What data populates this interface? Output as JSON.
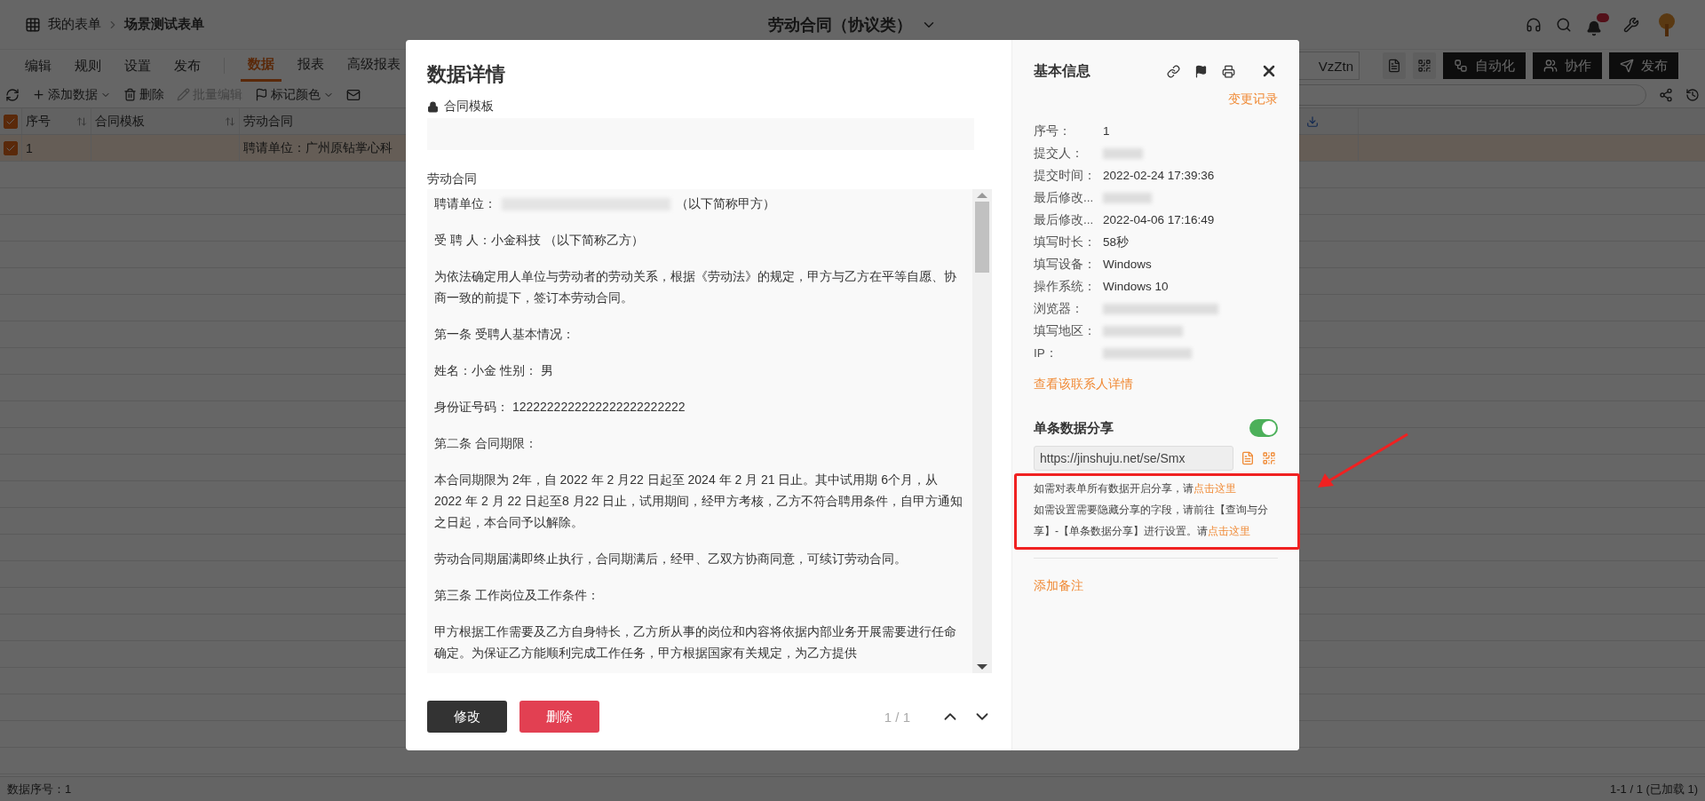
{
  "topbar": {
    "breadcrumb": [
      "我的表单",
      "场景测试表单"
    ],
    "title": "劳动合同（协议类）"
  },
  "menu": [
    "编辑",
    "规则",
    "设置",
    "发布"
  ],
  "tabs": [
    {
      "label": "数据",
      "selected": true
    },
    {
      "label": "报表",
      "selected": false
    },
    {
      "label": "高级报表",
      "selected": false
    }
  ],
  "form_link": {
    "value": "VzZtn"
  },
  "header_buttons": [
    "自动化",
    "协作",
    "发布"
  ],
  "toolbar": [
    {
      "label": "添加数据",
      "disabled": false,
      "dropdown": true
    },
    {
      "label": "删除",
      "disabled": false,
      "dropdown": false
    },
    {
      "label": "批量编辑",
      "disabled": true,
      "dropdown": false
    },
    {
      "label": "标记颜色",
      "disabled": false,
      "dropdown": true
    }
  ],
  "table": {
    "all_checked": true,
    "columns": [
      {
        "label": "序号",
        "sortable": true
      },
      {
        "label": "合同模板",
        "sortable": true
      },
      {
        "label": "劳动合同",
        "sortable": false
      }
    ],
    "rows": [
      {
        "checked": true,
        "selected": true,
        "number": "1",
        "contract": "聘请单位：广州原钻掌心科"
      }
    ]
  },
  "status_bar": {
    "left": "数据序号：1",
    "right": "1-1 / 1 (已加载 1)"
  },
  "modal": {
    "title": "数据详情",
    "template_field": {
      "label": "合同模板",
      "locked": true
    },
    "contract_label": "劳动合同",
    "paragraphs": [
      [
        {
          "text": "聘请单位："
        },
        {
          "redacted": true
        },
        {
          "text": "（以下简称甲方）"
        }
      ],
      [
        {
          "text": "受 聘 人：小金科技 （以下简称乙方）"
        }
      ],
      [
        {
          "text": "为依法确定用人单位与劳动者的劳动关系，根据《劳动法》的规定，甲方与乙方在平等自愿、协商一致的前提下，签订本劳动合同。"
        }
      ],
      [
        {
          "text": "第一条 受聘人基本情况："
        }
      ],
      [
        {
          "text": "姓名：小金 性别： 男"
        }
      ],
      [
        {
          "text": "身份证号码： 1222222222222222222222222"
        }
      ],
      [
        {
          "text": "第二条 合同期限："
        }
      ],
      [
        {
          "text": "本合同期限为 2年，自 2022 年 2 月22 日起至 2024 年 2 月 21 日止。其中试用期 6个月，从 2022 年 2 月 22 日起至8 月22 日止，试用期间，经甲方考核，乙方不符合聘用条件，自甲方通知之日起，本合同予以解除。"
        }
      ],
      [
        {
          "text": "劳动合同期届满即终止执行，合同期满后，经甲、乙双方协商同意，可续订劳动合同。"
        }
      ],
      [
        {
          "text": "第三条 工作岗位及工作条件："
        }
      ],
      [
        {
          "text": "甲方根据工作需要及乙方自身特长，乙方所从事的岗位和内容将依据内部业务开展需要进行任命确定。为保证乙方能顺利完成工作任务，甲方根据国家有关规定，为乙方提供"
        }
      ]
    ],
    "buttons": [
      {
        "label": "修改",
        "kind": "primary"
      },
      {
        "label": "删除",
        "kind": "danger"
      }
    ],
    "pager": "1 / 1"
  },
  "info": {
    "title": "基本信息",
    "change_log": "变更记录",
    "rows": [
      {
        "label": "序号：",
        "value": "1",
        "redacted": false
      },
      {
        "label": "提交人：",
        "redacted": true
      },
      {
        "label": "提交时间：",
        "value": "2022-02-24 17:39:36",
        "redacted": false
      },
      {
        "label": "最后修改...",
        "redacted": true
      },
      {
        "label": "最后修改...",
        "value": "2022-04-06 17:16:49",
        "redacted": false
      },
      {
        "label": "填写时长：",
        "value": "58秒",
        "redacted": false
      },
      {
        "label": "填写设备：",
        "value": "Windows",
        "redacted": false
      },
      {
        "label": "操作系统：",
        "value": "Windows 10",
        "redacted": false
      },
      {
        "label": "浏览器：",
        "redacted": true
      },
      {
        "label": "填写地区：",
        "redacted": true
      },
      {
        "label": "IP：",
        "redacted": true
      }
    ],
    "contact_link": "查看该联系人详情"
  },
  "share": {
    "title": "单条数据分享",
    "on": true,
    "url": "https://jinshuju.net/se/Smx",
    "hints": [
      [
        {
          "text": "如需对表单所有数据开启分享，请"
        },
        {
          "text": "点击这里",
          "link": true
        }
      ],
      [
        {
          "text": "如需设置需要隐藏分享的字段，请前往【查询与分享】-【单条数据分享】进行设置。请"
        },
        {
          "text": "点击这里",
          "link": true
        }
      ]
    ]
  },
  "add_note": "添加备注"
}
